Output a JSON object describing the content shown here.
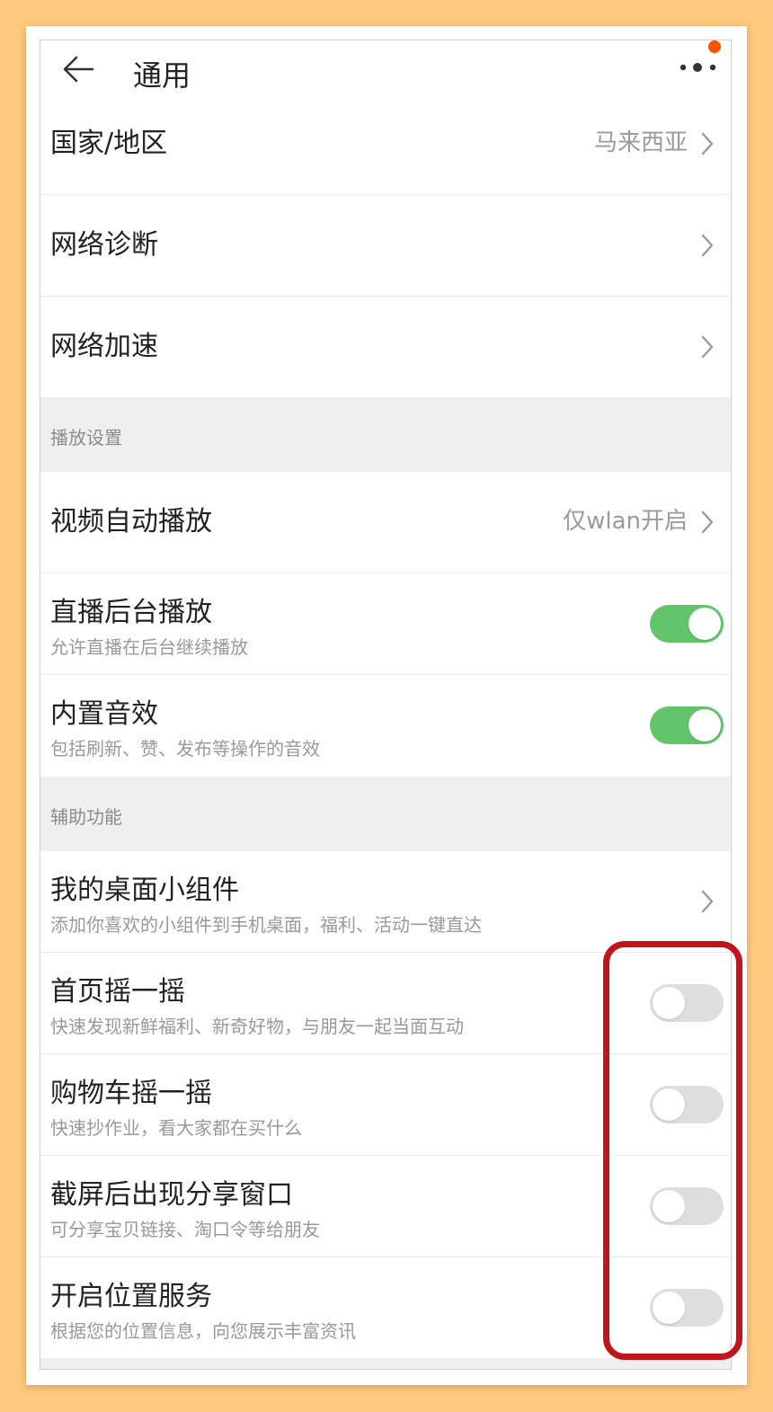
{
  "header": {
    "title": "通用",
    "back_icon": "arrow-left-icon",
    "more_icon": "more-dots-icon"
  },
  "rows_top": [
    {
      "label": "国家/地区",
      "value": "马来西亚"
    },
    {
      "label": "网络诊断",
      "value": ""
    },
    {
      "label": "网络加速",
      "value": ""
    }
  ],
  "section_playback": {
    "title": "播放设置"
  },
  "playback": {
    "autoplay": {
      "label": "视频自动播放",
      "value": "仅wlan开启"
    },
    "background_live": {
      "label": "直播后台播放",
      "sub": "允许直播在后台继续播放",
      "enabled": true
    },
    "sound_fx": {
      "label": "内置音效",
      "sub": "包括刷新、赞、发布等操作的音效",
      "enabled": true
    }
  },
  "section_accessibility": {
    "title": "辅助功能"
  },
  "accessibility": {
    "widgets": {
      "label": "我的桌面小组件",
      "sub": "添加你喜欢的小组件到手机桌面，福利、活动一键直达"
    },
    "home_shake": {
      "label": "首页摇一摇",
      "sub": "快速发现新鲜福利、新奇好物，与朋友一起当面互动",
      "enabled": false
    },
    "cart_shake": {
      "label": "购物车摇一摇",
      "sub": "快速抄作业，看大家都在买什么",
      "enabled": false
    },
    "screenshot_share": {
      "label": "截屏后出现分享窗口",
      "sub": "可分享宝贝链接、淘口令等给朋友",
      "enabled": false
    },
    "location": {
      "label": "开启位置服务",
      "sub": "根据您的位置信息，向您展示丰富资讯",
      "enabled": false
    }
  },
  "colors": {
    "toggle_on": "#62C56A",
    "toggle_off": "#DEDEDE",
    "highlight": "#C1141B",
    "notification": "#FF5000",
    "page_bg": "#FFC97E"
  }
}
